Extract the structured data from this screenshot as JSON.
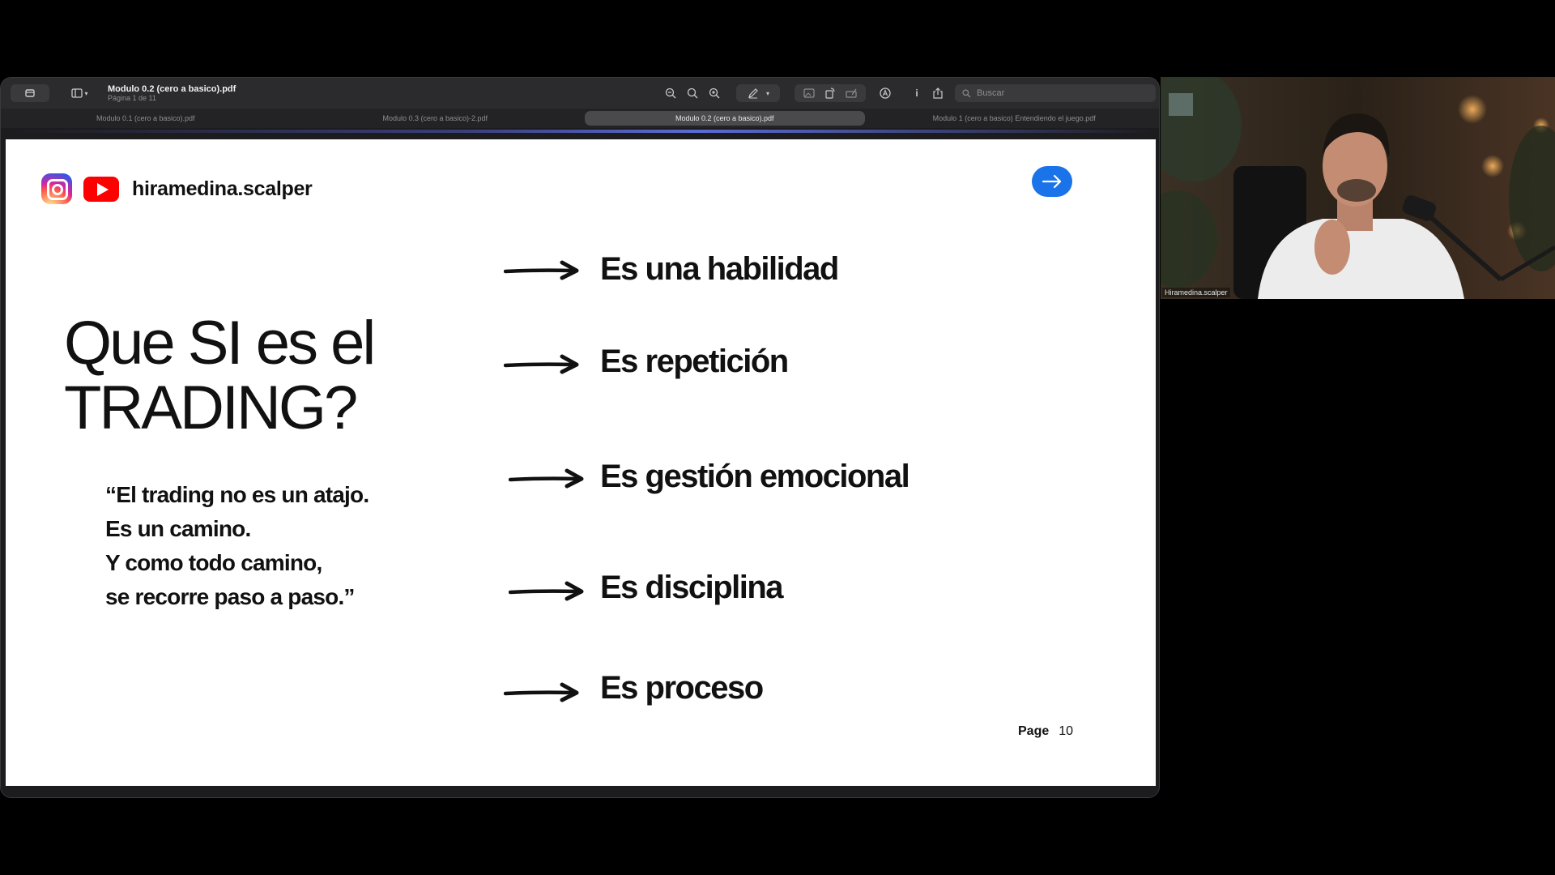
{
  "viewer": {
    "document_title": "Modulo 0.2 (cero a basico).pdf",
    "page_indicator": "Página 1 de 11",
    "search_placeholder": "Buscar",
    "tabs": [
      {
        "label": "Modulo 0.1 (cero a basico).pdf",
        "active": false
      },
      {
        "label": "Modulo 0.3 (cero a basico)-2.pdf",
        "active": false
      },
      {
        "label": "Modulo 0.2 (cero a basico).pdf",
        "active": true
      },
      {
        "label": "Modulo 1 (cero a basico) Entendiendo el juego.pdf",
        "active": false
      }
    ],
    "info_label": "i"
  },
  "slide": {
    "handle": "hiramedina.scalper",
    "title": "Que SI es el\nTRADING?",
    "quote": [
      "“El trading no es un atajo.",
      "Es un camino.",
      "Y como todo camino,",
      "se recorre paso a paso.”"
    ],
    "points": [
      "Es una habilidad",
      "Es repetición",
      "Es gestión emocional",
      "Es disciplina",
      "Es proceso"
    ],
    "page_label": "Page",
    "page_number": "10",
    "accent_color": "#1a73e8"
  },
  "webcam": {
    "name_label": "Hiramedina.scalper"
  }
}
